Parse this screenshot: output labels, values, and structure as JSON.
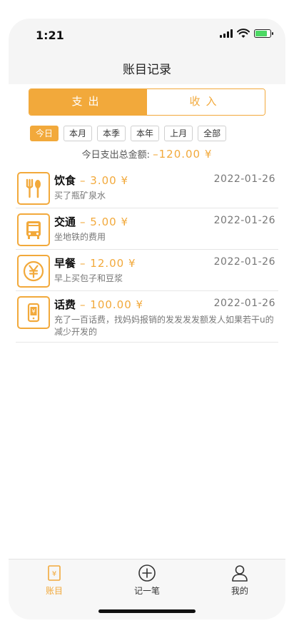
{
  "status": {
    "time": "1:21"
  },
  "nav": {
    "title": "账目记录"
  },
  "segment": {
    "expense": "支出",
    "income": "收入"
  },
  "filters": [
    "今日",
    "本月",
    "本季",
    "本年",
    "上月",
    "全部"
  ],
  "summary": {
    "label": "今日支出总金额:",
    "amount": "–120.00 ¥"
  },
  "records": [
    {
      "category": "饮食",
      "amount": "– 3.00 ¥",
      "date": "2022-01-26",
      "note": "买了瓶矿泉水",
      "icon": "fork-spoon-icon"
    },
    {
      "category": "交通",
      "amount": "– 5.00 ¥",
      "date": "2022-01-26",
      "note": "坐地铁的费用",
      "icon": "bus-icon"
    },
    {
      "category": "早餐",
      "amount": "– 12.00 ¥",
      "date": "2022-01-26",
      "note": "早上买包子和豆浆",
      "icon": "yen-coin-icon"
    },
    {
      "category": "话费",
      "amount": "– 100.00 ¥",
      "date": "2022-01-26",
      "note": "充了一百话费，找妈妈报销的发发发发额发人如果若干u的减少开发的",
      "icon": "phone-icon"
    }
  ],
  "tabs": {
    "ledger": "账目",
    "add": "记一笔",
    "mine": "我的"
  },
  "colors": {
    "accent": "#f2a93b"
  }
}
